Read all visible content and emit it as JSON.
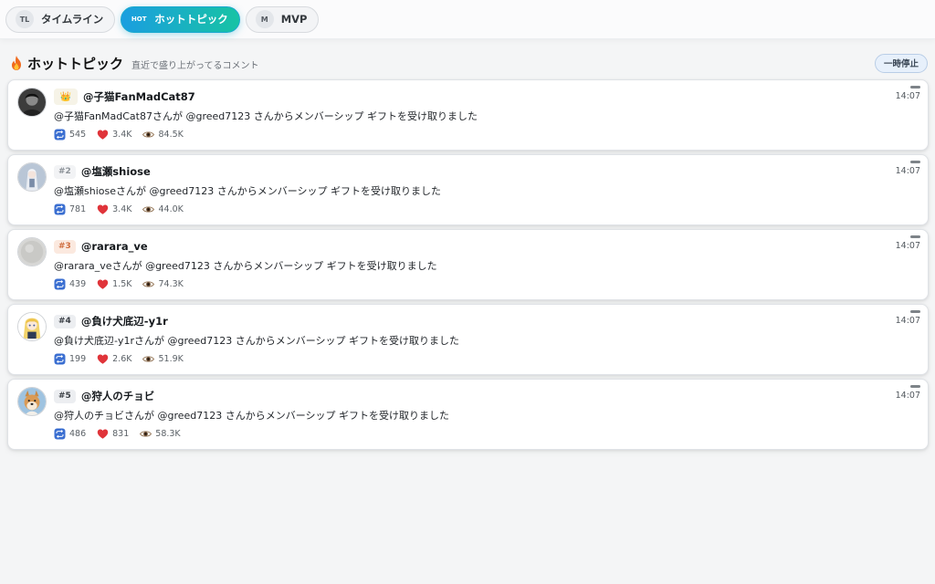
{
  "tabs": [
    {
      "badge": "TL",
      "label": "タイムライン",
      "active": false
    },
    {
      "badge": "HOT",
      "label": "ホットトピック",
      "active": true
    },
    {
      "badge": "M",
      "label": "MVP",
      "active": false
    }
  ],
  "section": {
    "title": "ホットトピック",
    "subtitle": "直近で盛り上がってるコメント",
    "pause_label": "一時停止"
  },
  "cards": [
    {
      "rank": "👑",
      "username": "@子猫FanMadCat87",
      "time": "14:07",
      "message": "@子猫FanMadCat87さんが @greed7123 さんからメンバーシップ ギフトを受け取りました",
      "reposts": "545",
      "likes": "3.4K",
      "views": "84.5K",
      "avatar": "dark-portrait"
    },
    {
      "rank": "#2",
      "username": "@塩瀬shiose",
      "time": "14:07",
      "message": "@塩瀬shioseさんが @greed7123 さんからメンバーシップ ギフトを受け取りました",
      "reposts": "781",
      "likes": "3.4K",
      "views": "44.0K",
      "avatar": "anime-character"
    },
    {
      "rank": "#3",
      "username": "@rarara_ve",
      "time": "14:07",
      "message": "@rarara_veさんが @greed7123 さんからメンバーシップ ギフトを受け取りました",
      "reposts": "439",
      "likes": "1.5K",
      "views": "74.3K",
      "avatar": "grey-circle"
    },
    {
      "rank": "#4",
      "username": "@負け犬底辺-y1r",
      "time": "14:07",
      "message": "@負け犬底辺-y1rさんが @greed7123 さんからメンバーシップ ギフトを受け取りました",
      "reposts": "199",
      "likes": "2.6K",
      "views": "51.9K",
      "avatar": "blonde-character"
    },
    {
      "rank": "#5",
      "username": "@狩人のチョビ",
      "time": "14:07",
      "message": "@狩人のチョビさんが @greed7123 さんからメンバーシップ ギフトを受け取りました",
      "reposts": "486",
      "likes": "831",
      "views": "58.3K",
      "avatar": "shiba-dog"
    }
  ],
  "colors": {
    "accent_start": "#1a9ee0",
    "accent_end": "#18c3a4",
    "like": "#e0343a",
    "repost": "#3b6fd1"
  },
  "icons": {
    "fire": "fire-icon",
    "repost": "repost-icon",
    "like": "heart-icon",
    "views": "eye-icon",
    "menu": "menu-dash-icon"
  }
}
